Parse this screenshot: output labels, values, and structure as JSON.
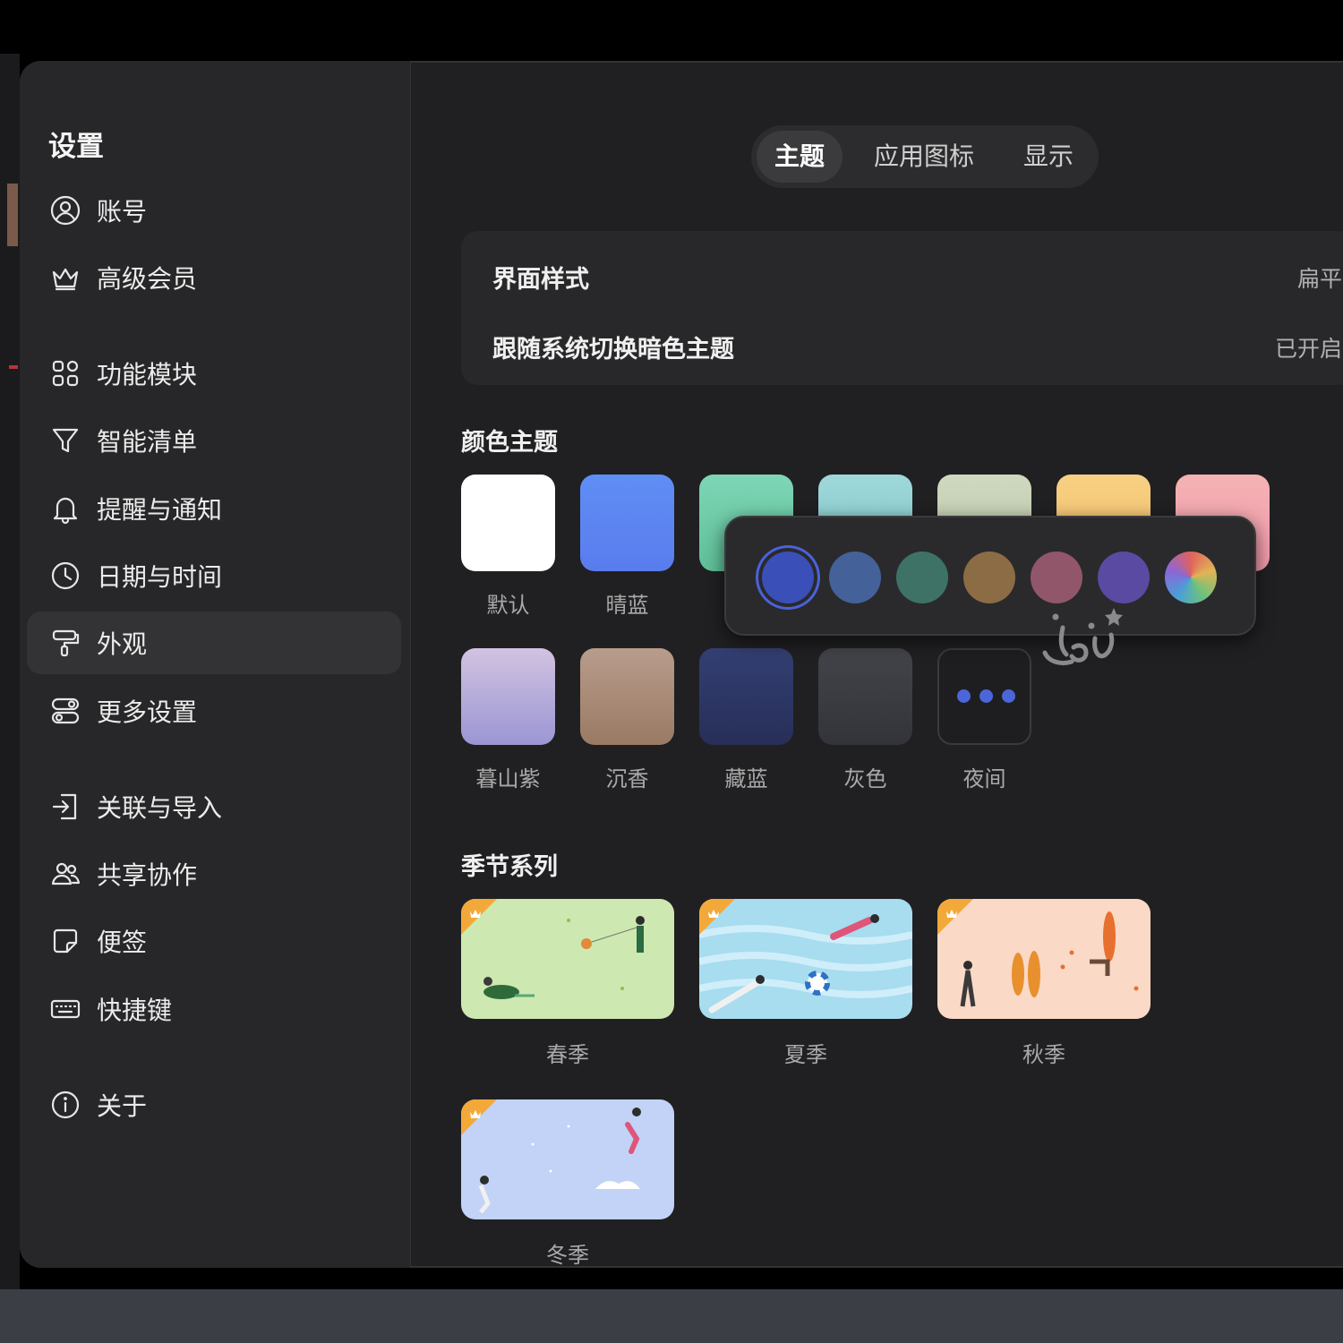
{
  "sidebar": {
    "title": "设置",
    "items": [
      {
        "label": "账号",
        "icon": "user-circle-icon"
      },
      {
        "label": "高级会员",
        "icon": "crown-icon"
      },
      {
        "label": "功能模块",
        "icon": "modules-icon"
      },
      {
        "label": "智能清单",
        "icon": "filter-icon"
      },
      {
        "label": "提醒与通知",
        "icon": "bell-icon"
      },
      {
        "label": "日期与时间",
        "icon": "clock-icon"
      },
      {
        "label": "外观",
        "icon": "paint-roller-icon",
        "active": true
      },
      {
        "label": "更多设置",
        "icon": "toggles-icon"
      },
      {
        "label": "关联与导入",
        "icon": "import-icon"
      },
      {
        "label": "共享协作",
        "icon": "users-icon"
      },
      {
        "label": "便签",
        "icon": "sticky-note-icon"
      },
      {
        "label": "快捷键",
        "icon": "keyboard-icon"
      },
      {
        "label": "关于",
        "icon": "info-icon"
      }
    ]
  },
  "tabs": [
    {
      "label": "主题",
      "active": true
    },
    {
      "label": "应用图标"
    },
    {
      "label": "显示"
    }
  ],
  "settings": {
    "style_label": "界面样式",
    "style_value": "扁平",
    "dark_follow_label": "跟随系统切换暗色主题",
    "dark_follow_value": "已开启"
  },
  "color_themes": {
    "title": "颜色主题",
    "row1": [
      {
        "label": "默认",
        "color": "#ffffff"
      },
      {
        "label": "晴蓝",
        "color": "#5b86f2"
      },
      {
        "label": "",
        "color": "#6fcfae"
      },
      {
        "label": "",
        "color": "#8fd0d4"
      },
      {
        "label": "",
        "color": "#c7d3b8"
      },
      {
        "label": "",
        "color": "#f6c77a"
      },
      {
        "label": "",
        "color": "#f3a4b0"
      }
    ],
    "row2": [
      {
        "label": "暮山紫",
        "color": "#a9a2d8"
      },
      {
        "label": "沉香",
        "color": "#a68a78"
      },
      {
        "label": "藏蓝",
        "color": "#2c3868"
      },
      {
        "label": "灰色",
        "color": "#3a3b42"
      },
      {
        "label": "夜间",
        "color": "#1e1e20",
        "selected": true
      }
    ]
  },
  "night_accents": {
    "selected_index": 0,
    "colors": [
      "#3b4fb8",
      "#456199",
      "#3e7267",
      "#8c6c44",
      "#92566a",
      "#5a4aa2",
      "conic-rainbow"
    ]
  },
  "seasons": {
    "title": "季节系列",
    "items": [
      {
        "label": "春季",
        "bg": "#cde8b0"
      },
      {
        "label": "夏季",
        "bg": "#a8dcef"
      },
      {
        "label": "秋季",
        "bg": "#fad9c6"
      },
      {
        "label": "冬季",
        "bg": "#c2d3f7"
      }
    ]
  }
}
